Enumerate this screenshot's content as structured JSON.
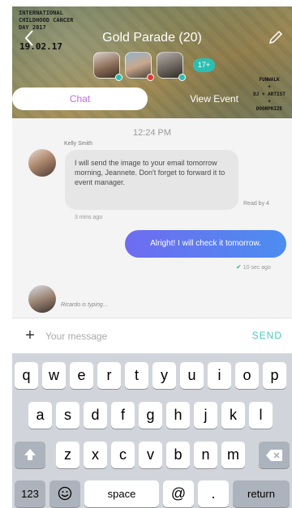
{
  "header": {
    "title": "Gold Parade (20)",
    "more_members": "17+",
    "tabs": {
      "chat": "Chat",
      "view_event": "View Event"
    },
    "poster": {
      "line1": "INTERNATIONAL",
      "line2": "CHILDHOOD CANCER",
      "line3": "DAY 2017",
      "date": "19.02.17",
      "right_lines": [
        "FUNWALK",
        "+",
        "DJ + ARTIST",
        "+",
        "DOORPRIZE"
      ]
    },
    "member_status_colors": [
      "#2bbfb2",
      "#e53935",
      "#2bbfb2"
    ]
  },
  "chat": {
    "time_divider": "12:24 PM",
    "incoming": {
      "sender": "Kelly Smith",
      "text": "I will send the image to your email tomorrow morning,  Jeannete. Don't forget to forward it to event manager.",
      "read_by": "Read by 4",
      "timestamp": "3 mins ago"
    },
    "outgoing": {
      "text": "Alright! I will check it tomorrow.",
      "timestamp": "10 sec ago"
    },
    "typing": "Ricardo is typing..."
  },
  "composer": {
    "placeholder": "Your message",
    "send_label": "SEND",
    "plus_label": "+"
  },
  "keyboard": {
    "row1": [
      "q",
      "w",
      "e",
      "r",
      "t",
      "y",
      "u",
      "i",
      "o",
      "p"
    ],
    "row2": [
      "a",
      "s",
      "d",
      "f",
      "g",
      "h",
      "j",
      "k",
      "l"
    ],
    "row3": [
      "z",
      "x",
      "c",
      "v",
      "b",
      "n",
      "m"
    ],
    "num": "123",
    "space": "space",
    "at": "@",
    "dot": ".",
    "return": "return"
  },
  "colors": {
    "accent_purple": "#c46ce3",
    "bubble_gradient_start": "#6e6cf0",
    "bubble_gradient_end": "#4c8df0",
    "send": "#4cc8c0",
    "badge": "#2bbfb2"
  }
}
